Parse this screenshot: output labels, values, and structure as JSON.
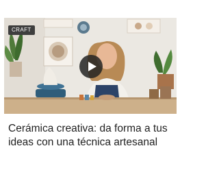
{
  "card": {
    "badge": "CRAFT",
    "title": "Cerámica creativa: da forma a tus ideas con una técnica artesanal",
    "play_icon": "play-icon"
  },
  "colors": {
    "badge_bg": "#3e3e3e",
    "title_text": "#1f1f1f",
    "play_bg": "#232323"
  }
}
